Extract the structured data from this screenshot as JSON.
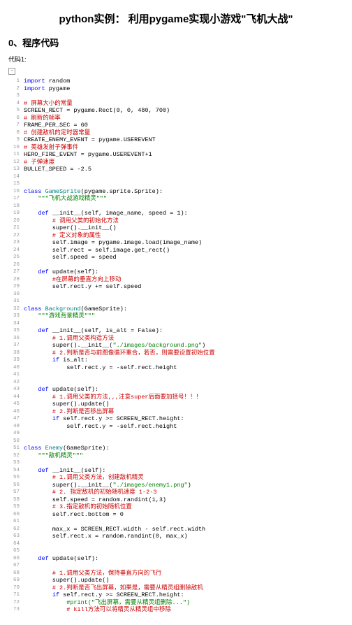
{
  "title": "python实例： 利用pygame实现小游戏\"飞机大战\"",
  "section": "0、程序代码",
  "sub": "代码1:",
  "tog": "−",
  "code": [
    {
      "n": 1,
      "h": "<span class='kw'>import</span> random"
    },
    {
      "n": 2,
      "h": "<span class='kw'>import</span> pygame"
    },
    {
      "n": 3,
      "h": ""
    },
    {
      "n": 4,
      "h": "<span class='com2'># 屏幕大小的常量</span>"
    },
    {
      "n": 5,
      "h": "SCREEN_RECT = pygame.Rect(0, 0, 480, 700)"
    },
    {
      "n": 6,
      "h": "<span class='com2'># 刷新的帧率</span>"
    },
    {
      "n": 7,
      "h": "FRAME_PER_SEC = 60"
    },
    {
      "n": 8,
      "h": "<span class='com2'># 创建敌机的定时器常量</span>"
    },
    {
      "n": 9,
      "h": "CREATE_ENEMY_EVENT = pygame.USEREVENT"
    },
    {
      "n": 10,
      "h": "<span class='com2'># 英雄发射子弹事件</span>"
    },
    {
      "n": 11,
      "h": "HERO_FIRE_EVENT = pygame.USEREVENT+1"
    },
    {
      "n": 12,
      "h": "<span class='com2'># 子弹速度</span>"
    },
    {
      "n": 13,
      "h": "BULLET_SPEED = -2.5"
    },
    {
      "n": 14,
      "h": ""
    },
    {
      "n": 15,
      "h": ""
    },
    {
      "n": 16,
      "h": "<span class='kw'>class</span> <span class='cls'>GameSprite</span>(pygame.sprite.Sprite):"
    },
    {
      "n": 17,
      "h": "    <span class='str'>\"\"\"飞机大战游戏精灵\"\"\"</span>"
    },
    {
      "n": 18,
      "h": ""
    },
    {
      "n": 19,
      "h": "    <span class='kw'>def</span> __init__(self, image_name, speed = 1):"
    },
    {
      "n": 20,
      "h": "        <span class='com2'># 调用父类的初始化方法</span>"
    },
    {
      "n": 21,
      "h": "        super().__init__()"
    },
    {
      "n": 22,
      "h": "        <span class='com2'># 定义对象的属性</span>"
    },
    {
      "n": 23,
      "h": "        self.image = pygame.image.load(image_name)"
    },
    {
      "n": 24,
      "h": "        self.rect = self.image.get_rect()"
    },
    {
      "n": 25,
      "h": "        self.speed = speed"
    },
    {
      "n": 26,
      "h": ""
    },
    {
      "n": 27,
      "h": "    <span class='kw'>def</span> update(self):"
    },
    {
      "n": 28,
      "h": "        <span class='com2'>#在屏幕的垂直方向上移动</span>"
    },
    {
      "n": 29,
      "h": "        self.rect.y += self.speed"
    },
    {
      "n": 30,
      "h": ""
    },
    {
      "n": 31,
      "h": ""
    },
    {
      "n": 32,
      "h": "<span class='kw'>class</span> <span class='cls'>Background</span>(GameSprite):"
    },
    {
      "n": 33,
      "h": "    <span class='str'>\"\"\"游戏背景精灵\"\"\"</span>"
    },
    {
      "n": 34,
      "h": ""
    },
    {
      "n": 35,
      "h": "    <span class='kw'>def</span> __init__(self, is_alt = False):"
    },
    {
      "n": 36,
      "h": "        <span class='com2'># 1.调用父类构造方法</span>"
    },
    {
      "n": 37,
      "h": "        super().__init__(<span class='str'>\"./images/background.png\"</span>)"
    },
    {
      "n": 38,
      "h": "        <span class='com2'># 2.判断是否与前图像循环重合，若否，则需要设置初始位置</span>"
    },
    {
      "n": 39,
      "h": "        <span class='kw'>if</span> is_alt:"
    },
    {
      "n": 40,
      "h": "            self.rect.y = -self.rect.height"
    },
    {
      "n": 41,
      "h": ""
    },
    {
      "n": 42,
      "h": ""
    },
    {
      "n": 43,
      "h": "    <span class='kw'>def</span> update(self):"
    },
    {
      "n": 44,
      "h": "        <span class='com2'># 1.调用父类的方法,,,注意super后面要加括号！！！</span>"
    },
    {
      "n": 45,
      "h": "        super().update()"
    },
    {
      "n": 46,
      "h": "        <span class='com2'># 2.判断是否移出屏幕</span>"
    },
    {
      "n": 47,
      "h": "        <span class='kw'>if</span> self.rect.y >= SCREEN_RECT.height:"
    },
    {
      "n": 48,
      "h": "            self.rect.y = -self.rect.height"
    },
    {
      "n": 49,
      "h": ""
    },
    {
      "n": 50,
      "h": ""
    },
    {
      "n": 51,
      "h": "<span class='kw'>class</span> <span class='cls'>Enemy</span>(GameSprite):"
    },
    {
      "n": 52,
      "h": "    <span class='str'>\"\"\"敌机精灵\"\"\"</span>"
    },
    {
      "n": 53,
      "h": ""
    },
    {
      "n": 54,
      "h": "    <span class='kw'>def</span> __init__(self):"
    },
    {
      "n": 55,
      "h": "        <span class='com2'># 1.调用父类方法，创建敌机精灵</span>"
    },
    {
      "n": 56,
      "h": "        super().__init__(<span class='str'>\"./images/enemy1.png\"</span>)"
    },
    {
      "n": 57,
      "h": "        <span class='com2'># 2. 指定敌机的初始随机速度 1-2-3</span>"
    },
    {
      "n": 58,
      "h": "        self.speed = random.randint(1,3)"
    },
    {
      "n": 59,
      "h": "        <span class='com2'># 3.指定敌机的初始随机位置</span>"
    },
    {
      "n": 60,
      "h": "        self.rect.bottom = 0"
    },
    {
      "n": 61,
      "h": ""
    },
    {
      "n": 62,
      "h": "        max_x = SCREEN_RECT.width - self.rect.width"
    },
    {
      "n": 63,
      "h": "        self.rect.x = random.randint(0, max_x)"
    },
    {
      "n": 64,
      "h": ""
    },
    {
      "n": 65,
      "h": ""
    },
    {
      "n": 66,
      "h": "    <span class='kw'>def</span> update(self):"
    },
    {
      "n": 67,
      "h": ""
    },
    {
      "n": 68,
      "h": "        <span class='com2'># 1.调用父类方法，保持垂直方向的飞行</span>"
    },
    {
      "n": 69,
      "h": "        super().update()"
    },
    {
      "n": 70,
      "h": "        <span class='com2'># 2.判断是否飞出屏幕，如果是，需要从精灵组删除敌机</span>"
    },
    {
      "n": 71,
      "h": "        <span class='kw'>if</span> self.rect.y >= SCREEN_RECT.height:"
    },
    {
      "n": 72,
      "h": "            <span class='com'>#print(\"飞出屏幕，需要从精灵组删除...\")</span>"
    },
    {
      "n": 73,
      "h": "            <span class='com2'># kill方法可以将精灵从精灵组中移除</span>"
    }
  ]
}
